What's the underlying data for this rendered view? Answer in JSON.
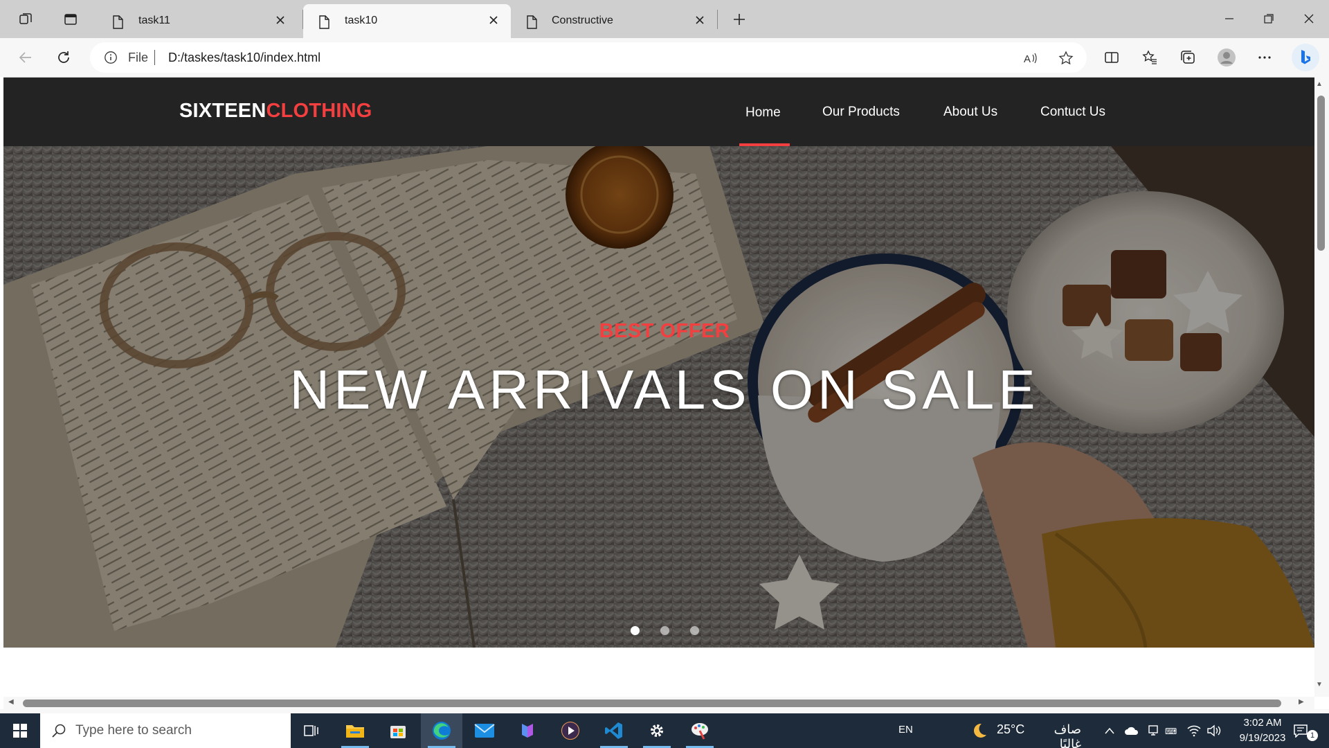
{
  "browser": {
    "tabs": [
      {
        "title": "task11",
        "active": false
      },
      {
        "title": "task10",
        "active": true
      },
      {
        "title": "Constructive",
        "active": false
      }
    ],
    "address": {
      "scheme": "File",
      "url": "D:/taskes/task10/index.html"
    },
    "accent": "#1a73e8"
  },
  "site": {
    "brand": {
      "part1": "SIXTEEN",
      "part2": "CLOTHING",
      "accent": "#f33f3f"
    },
    "nav": {
      "home": "Home",
      "products": "Our Products",
      "about": "About Us",
      "contact": "Contuct Us",
      "active": "Home"
    },
    "hero": {
      "kicker": "BEST OFFER",
      "title": "NEW ARRIVALS ON SALE",
      "slides": 3,
      "active_slide": 1
    }
  },
  "taskbar": {
    "search_placeholder": "Type here to search",
    "apps": [
      "task-view-icon",
      "file-explorer-icon",
      "store-icon",
      "edge-icon",
      "mail-icon",
      "copilot-icon",
      "media-player-icon",
      "vscode-icon",
      "settings-icon",
      "paint-icon"
    ],
    "language": "EN",
    "weather_temp": "25°C",
    "weather_text": "صاف غالبًا",
    "time": "3:02 AM",
    "date": "9/19/2023",
    "notification_count": "1"
  }
}
